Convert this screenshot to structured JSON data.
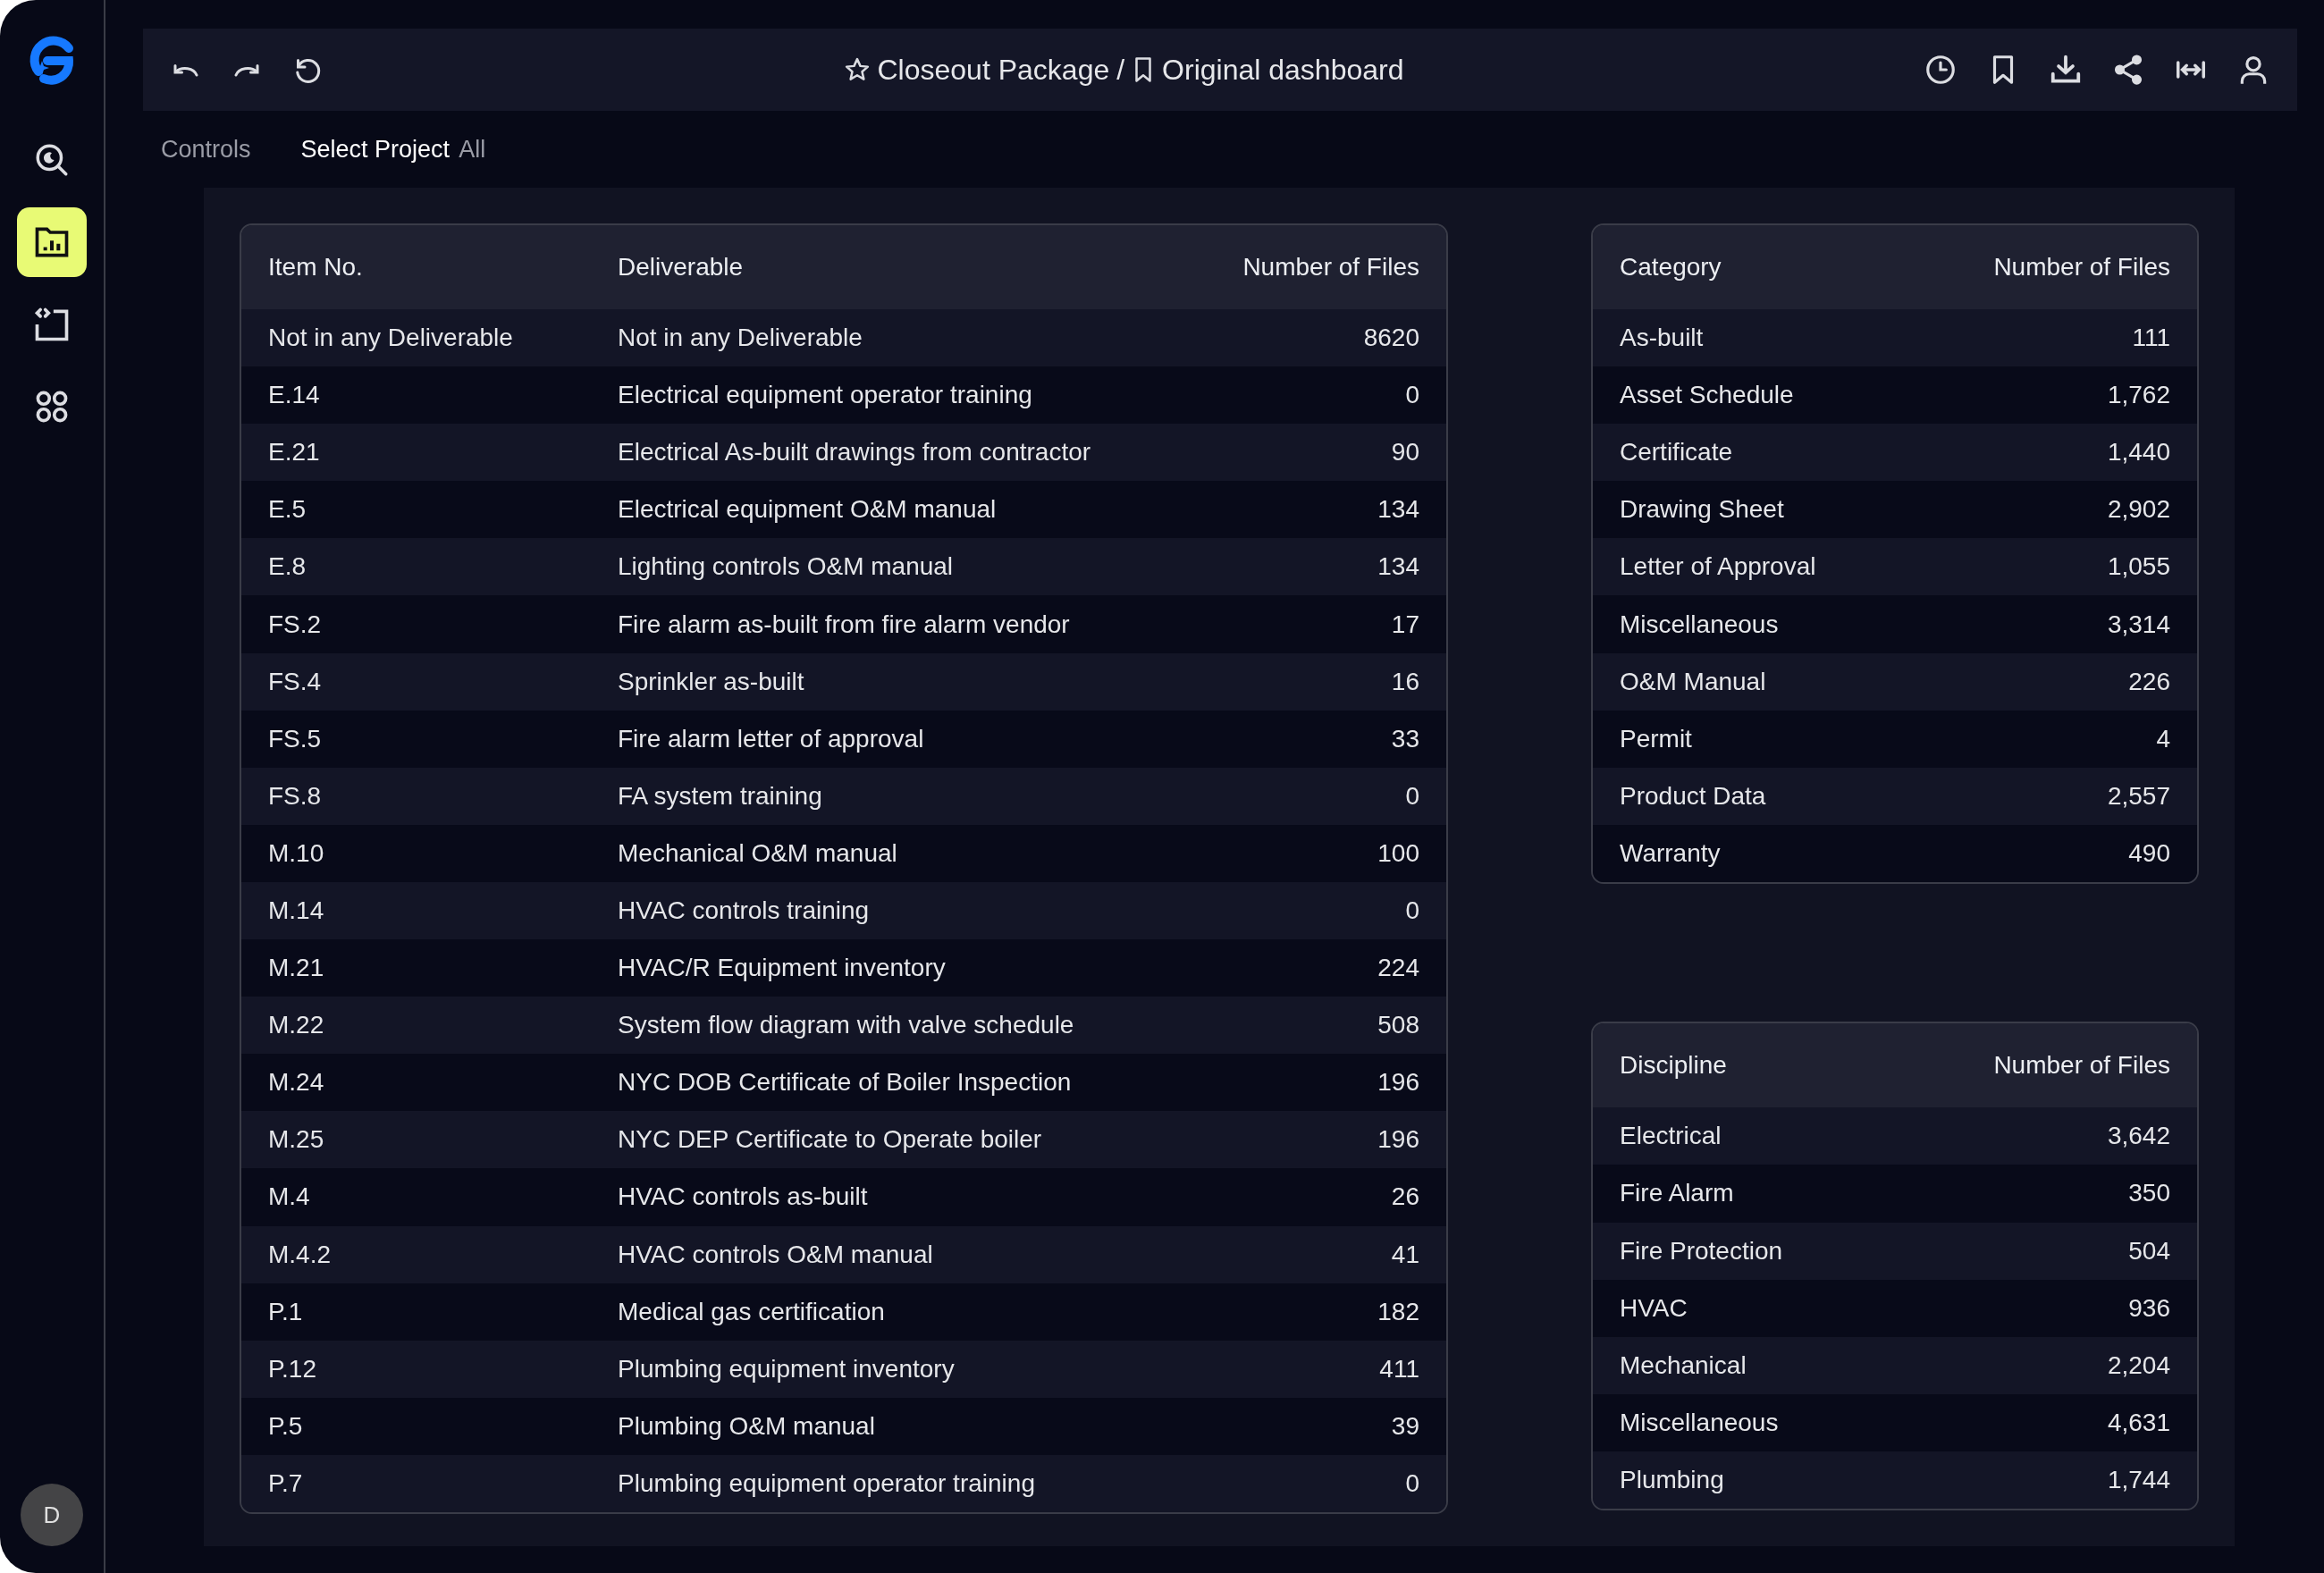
{
  "sidebar": {
    "items": [
      {
        "kind": "search",
        "selected": false
      },
      {
        "kind": "folder",
        "selected": true
      },
      {
        "kind": "code",
        "selected": false
      },
      {
        "kind": "apps",
        "selected": false
      }
    ],
    "avatar": "D"
  },
  "toolbar": {
    "title": "Closeout Package",
    "separator": "/",
    "subtitle": "Original dashboard"
  },
  "filters": {
    "controls_label": "Controls",
    "project_label": "Select Project",
    "project_value": "All"
  },
  "deliverables_table": {
    "columns": [
      "Item No.",
      "Deliverable",
      "Number of Files"
    ],
    "rows": [
      [
        "Not in any Deliverable",
        "Not in any Deliverable",
        "8620"
      ],
      [
        "E.14",
        "Electrical equipment operator training",
        "0"
      ],
      [
        "E.21",
        "Electrical As-built drawings from contractor",
        "90"
      ],
      [
        "E.5",
        "Electrical equipment O&M manual",
        "134"
      ],
      [
        "E.8",
        "Lighting controls O&M manual",
        "134"
      ],
      [
        "FS.2",
        "Fire alarm as-built from fire alarm vendor",
        "17"
      ],
      [
        "FS.4",
        "Sprinkler as-built",
        "16"
      ],
      [
        "FS.5",
        "Fire alarm letter of approval",
        "33"
      ],
      [
        "FS.8",
        "FA system training",
        "0"
      ],
      [
        "M.10",
        "Mechanical O&M manual",
        "100"
      ],
      [
        "M.14",
        "HVAC controls training",
        "0"
      ],
      [
        "M.21",
        "HVAC/R Equipment inventory",
        "224"
      ],
      [
        "M.22",
        "System flow diagram with valve schedule",
        "508"
      ],
      [
        "M.24",
        "NYC DOB Certificate of Boiler Inspection",
        "196"
      ],
      [
        "M.25",
        "NYC DEP Certificate to Operate boiler",
        "196"
      ],
      [
        "M.4",
        "HVAC controls as-built",
        "26"
      ],
      [
        "M.4.2",
        "HVAC controls O&M manual",
        "41"
      ],
      [
        "P.1",
        "Medical gas certification",
        "182"
      ],
      [
        "P.12",
        "Plumbing equipment inventory",
        "411"
      ],
      [
        "P.5",
        "Plumbing O&M manual",
        "39"
      ],
      [
        "P.7",
        "Plumbing equipment operator training",
        "0"
      ]
    ]
  },
  "category_table": {
    "columns": [
      "Category",
      "Number of Files"
    ],
    "rows": [
      [
        "As-built",
        "111"
      ],
      [
        "Asset Schedule",
        "1,762"
      ],
      [
        "Certificate",
        "1,440"
      ],
      [
        "Drawing Sheet",
        "2,902"
      ],
      [
        "Letter of Approval",
        "1,055"
      ],
      [
        "Miscellaneous",
        "3,314"
      ],
      [
        "O&M Manual",
        "226"
      ],
      [
        "Permit",
        "4"
      ],
      [
        "Product Data",
        "2,557"
      ],
      [
        "Warranty",
        "490"
      ]
    ]
  },
  "discipline_table": {
    "columns": [
      "Discipline",
      "Number of Files"
    ],
    "rows": [
      [
        "Electrical",
        "3,642"
      ],
      [
        "Fire Alarm",
        "350"
      ],
      [
        "Fire Protection",
        "504"
      ],
      [
        "HVAC",
        "936"
      ],
      [
        "Mechanical",
        "2,204"
      ],
      [
        "Miscellaneous",
        "4,631"
      ],
      [
        "Plumbing",
        "1,744"
      ]
    ]
  }
}
